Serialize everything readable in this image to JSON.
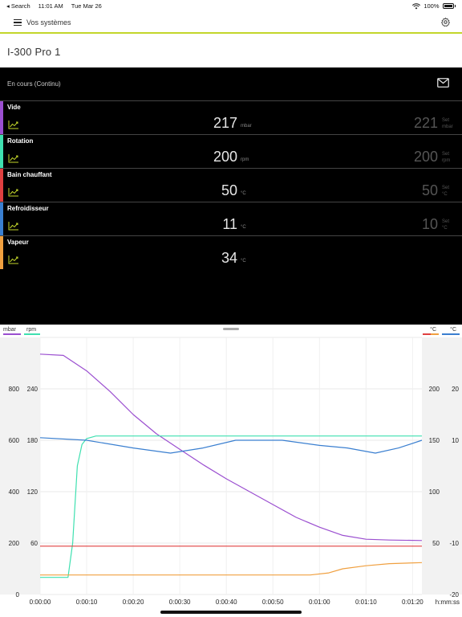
{
  "status": {
    "carrier": "◂ Search",
    "time": "11:01 AM",
    "date": "Tue Mar 26",
    "battery": "100%"
  },
  "nav": {
    "title": "Vos systèmes"
  },
  "device": {
    "title": "I-300 Pro 1"
  },
  "run": {
    "status": "En cours (Continu)"
  },
  "params": [
    {
      "name": "Vide",
      "value": "217",
      "unit": "mbar",
      "set_value": "221",
      "set_label": "Set",
      "set_unit": "mbar",
      "color": "#9b4fd0"
    },
    {
      "name": "Rotation",
      "value": "200",
      "unit": "rpm",
      "set_value": "200",
      "set_label": "Set",
      "set_unit": "rpm",
      "color": "#3fe0b0"
    },
    {
      "name": "Bain chauffant",
      "value": "50",
      "unit": "°C",
      "set_value": "50",
      "set_label": "Set",
      "set_unit": "°C",
      "color": "#e04040"
    },
    {
      "name": "Refroidisseur",
      "value": "11",
      "unit": "°C",
      "set_value": "10",
      "set_label": "Set",
      "set_unit": "°C",
      "color": "#3a7fd0"
    },
    {
      "name": "Vapeur",
      "value": "34",
      "unit": "°C",
      "set_value": "",
      "set_label": "",
      "set_unit": "",
      "color": "#f0a040"
    }
  ],
  "axis_headers": {
    "left1": {
      "label": "mbar",
      "color": "#9b4fd0"
    },
    "left2": {
      "label": "rpm",
      "color": "#3fe0b0"
    },
    "right1": {
      "label": "°C",
      "color": "#e04040"
    },
    "right2": {
      "label": "°C",
      "color": "#3a7fd0"
    }
  },
  "chart_data": {
    "type": "line",
    "x_unit": "h:mm:ss",
    "x_ticks": [
      "0:00:00",
      "0:00:10",
      "0:00:20",
      "0:00:30",
      "0:00:40",
      "0:00:50",
      "0:01:00",
      "0:01:10",
      "0:01:20"
    ],
    "axes": {
      "mbar": {
        "range": [
          0,
          1000
        ],
        "ticks": [
          "0",
          "200",
          "400",
          "600",
          "800"
        ],
        "tick_values": [
          0,
          200,
          400,
          600,
          800
        ]
      },
      "rpm": {
        "range": [
          0,
          300
        ],
        "ticks": [
          "60",
          "120",
          "180",
          "240"
        ],
        "tick_values": [
          60,
          120,
          180,
          240
        ]
      },
      "bath_c": {
        "range": [
          0,
          250
        ],
        "ticks": [
          "50",
          "100",
          "150",
          "200"
        ],
        "tick_values": [
          50,
          100,
          150,
          200
        ]
      },
      "chiller_c": {
        "range": [
          -20,
          30
        ],
        "ticks": [
          "-20",
          "-10",
          "10",
          "20"
        ],
        "tick_values": [
          -20,
          -10,
          10,
          20
        ]
      }
    },
    "series": [
      {
        "axis": "mbar",
        "color": "#9b4fd0",
        "points": [
          [
            0,
            935
          ],
          [
            5,
            930
          ],
          [
            10,
            870
          ],
          [
            15,
            790
          ],
          [
            20,
            700
          ],
          [
            25,
            625
          ],
          [
            30,
            565
          ],
          [
            35,
            505
          ],
          [
            40,
            450
          ],
          [
            45,
            400
          ],
          [
            50,
            350
          ],
          [
            55,
            300
          ],
          [
            60,
            262
          ],
          [
            65,
            230
          ],
          [
            70,
            215
          ],
          [
            75,
            212
          ],
          [
            82,
            210
          ]
        ]
      },
      {
        "axis": "rpm",
        "color": "#3fe0b0",
        "points": [
          [
            0,
            20
          ],
          [
            6,
            20
          ],
          [
            7,
            60
          ],
          [
            8,
            150
          ],
          [
            9,
            175
          ],
          [
            10,
            182
          ],
          [
            12,
            185
          ],
          [
            20,
            185
          ],
          [
            40,
            185
          ],
          [
            60,
            185
          ],
          [
            82,
            185
          ]
        ]
      },
      {
        "axis": "bath_c",
        "color": "#e04040",
        "points": [
          [
            0,
            47
          ],
          [
            20,
            47
          ],
          [
            40,
            47
          ],
          [
            60,
            47
          ],
          [
            82,
            47
          ]
        ]
      },
      {
        "axis": "chiller_c",
        "color": "#3a7fd0",
        "points": [
          [
            0,
            10.5
          ],
          [
            10,
            10
          ],
          [
            20,
            8.5
          ],
          [
            28,
            7.5
          ],
          [
            35,
            8.5
          ],
          [
            42,
            10
          ],
          [
            52,
            10
          ],
          [
            60,
            9
          ],
          [
            66,
            8.5
          ],
          [
            72,
            7.5
          ],
          [
            77,
            8.5
          ],
          [
            82,
            10
          ]
        ]
      },
      {
        "axis": "bath_c",
        "color": "#f0a040",
        "points": [
          [
            0,
            19
          ],
          [
            20,
            19
          ],
          [
            40,
            19
          ],
          [
            50,
            19
          ],
          [
            58,
            19
          ],
          [
            62,
            21
          ],
          [
            65,
            25
          ],
          [
            70,
            28
          ],
          [
            75,
            30
          ],
          [
            82,
            31
          ]
        ]
      }
    ],
    "grid": true
  }
}
